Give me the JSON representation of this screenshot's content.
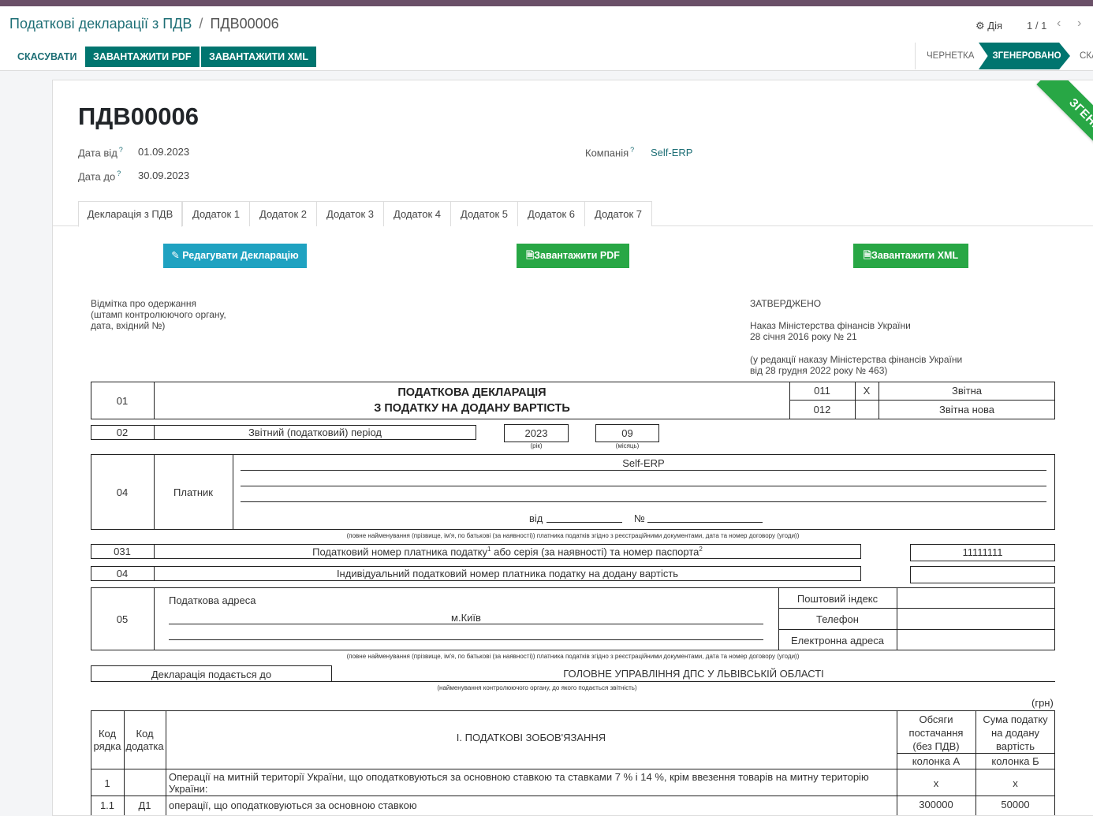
{
  "breadcrumb": {
    "parent": "Податкові декларації з ПДВ",
    "separator": "/",
    "current": "ПДВ00006"
  },
  "actions": {
    "label": "Дія"
  },
  "pager": {
    "value": "1 / 1",
    "prev": "‹",
    "next": "›"
  },
  "buttons": {
    "cancel": "СКАСУВАТИ",
    "download_pdf": "ЗАВАНТАЖИТИ PDF",
    "download_xml": "ЗАВАНТАЖИТИ XML"
  },
  "statusbar": {
    "draft": "ЧЕРНЕТКА",
    "generated": "ЗГЕНЕРОВАНО",
    "cancelled": "СКА"
  },
  "ribbon": "ЗГЕНЕРОВАНО",
  "record": {
    "title": "ПДВ00006",
    "date_from_label": "Дата від",
    "date_from": "01.09.2023",
    "date_to_label": "Дата до",
    "date_to": "30.09.2023",
    "company_label": "Компанія",
    "company": "Self-ERP",
    "tip": "?"
  },
  "tabs": [
    "Декларація з ПДВ",
    "Додаток 1",
    "Додаток 2",
    "Додаток 3",
    "Додаток 4",
    "Додаток 5",
    "Додаток 6",
    "Додаток 7"
  ],
  "form_buttons": {
    "edit": "Редагувати Декларацію",
    "pdf": "Завантажити PDF",
    "xml": "Завантажити XML"
  },
  "form": {
    "stamp": [
      "Відмітка про одержання",
      "(штамп контролюючого органу,",
      "дата, вхідний №)"
    ],
    "approved": "ЗАТВЕРДЖЕНО",
    "order1": [
      "Наказ Міністерства фінансів України",
      "28 січня 2016 року № 21"
    ],
    "order2": [
      "(у редакції наказу Міністерства фінансів України",
      "від 28 грудня 2022 року № 463)"
    ],
    "row01_code": "01",
    "title1": "ПОДАТКОВА ДЕКЛАРАЦІЯ",
    "title2": "З ПОДАТКУ НА ДОДАНУ ВАРТІСТЬ",
    "c011": "011",
    "c011_mark": "X",
    "c011_label": "Звітна",
    "c012": "012",
    "c012_label": "Звітна нова",
    "row02_code": "02",
    "period_label": "Звітний (податковий) період",
    "year": "2023",
    "year_note": "(рік)",
    "month": "09",
    "month_note": "(місяць)",
    "row04_code": "04",
    "payer_label": "Платник",
    "payer_name": "Self-ERP",
    "from_label": "від",
    "num_label": "№",
    "payer_note": "(повне найменування (прізвище, ім'я, по батькові (за наявності)) платника податків згідно з реєстраційними документами, дата та номер договору (угоди))",
    "row031_code": "031",
    "tax_id_label": "Податковий номер платника податку",
    "tax_id_sup1": "1",
    "tax_id_mid": " або серія (за наявності) та номер паспорта",
    "tax_id_sup2": "2",
    "tax_id": "11111111",
    "row04b_code": "04",
    "vat_id_label": "Індивідуальний податковий номер платника податку на додану вартість",
    "row05_code": "05",
    "address_label": "Податкова адреса",
    "city": "м.Київ",
    "postal_label": "Поштовий індекс",
    "phone_label": "Телефон",
    "email_label": "Електронна адреса",
    "address_note": "(повне найменування (прізвище, ім'я, по батькові (за наявності)) платника податків згідно з реєстраційними документами, дата та номер договору (угоди))",
    "submit_label": "Декларація подається до",
    "authority": "ГОЛОВНЕ УПРАВЛІННЯ ДПС У ЛЬВІВСЬКІЙ ОБЛАСТІ",
    "authority_note": "(найменування контролюючого органу, до якого подається звітність)",
    "currency": "(грн)"
  },
  "section1": {
    "col_code": [
      "Код",
      "рядка"
    ],
    "col_appendix": [
      "Код",
      "додатка"
    ],
    "title": "І. ПОДАТКОВІ ЗОБОВ'ЯЗАННЯ",
    "col_a": [
      "Обсяги",
      "постачання",
      "(без ПДВ)"
    ],
    "col_a_sub": "колонка А",
    "col_b": [
      "Сума податку",
      "на додану",
      "вартість"
    ],
    "col_b_sub": "колонка Б",
    "rows": [
      {
        "code": "1",
        "appendix": "",
        "text": [
          "Операції на митній території України, що оподатковуються за основною ставкою та ставками 7 % і 14 %, крім ввезення товарів на митну територію",
          "України:"
        ],
        "a": "x",
        "b": "x"
      },
      {
        "code": "1.1",
        "appendix": "Д1",
        "text": [
          "операції, що оподатковуються за основною ставкою"
        ],
        "a": "300000",
        "b": "50000"
      }
    ]
  }
}
